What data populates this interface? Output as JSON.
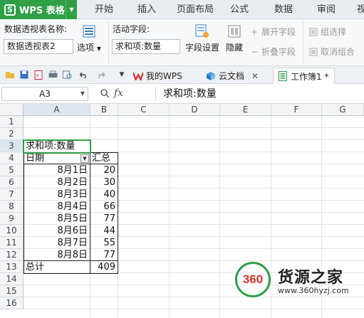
{
  "app": {
    "title": "WPS 表格"
  },
  "menu": [
    "开始",
    "插入",
    "页面布局",
    "公式",
    "数据",
    "审阅",
    "视"
  ],
  "ribbon": {
    "pivot_name_label": "数据透视表名称:",
    "pivot_name_value": "数据透视表2",
    "options_label": "选项",
    "active_field_label": "活动字段:",
    "active_field_value": "求和项:数量",
    "field_settings_label": "字段设置",
    "hide_label": "隐藏",
    "expand_field_label": "展开字段",
    "collapse_field_label": "折叠字段",
    "group_select_label": "组选择",
    "ungroup_label": "取消组合"
  },
  "tabs": {
    "my_wps": "我的WPS",
    "cloud_docs": "云文档",
    "workbook": "工作簿1 *"
  },
  "formula_bar": {
    "name_box": "A3",
    "fx": "fx",
    "formula": "求和项:数量"
  },
  "grid": {
    "columns": [
      "A",
      "B",
      "C",
      "D",
      "E",
      "F",
      "G"
    ],
    "rows": [
      "1",
      "2",
      "3",
      "4",
      "5",
      "6",
      "7",
      "8",
      "9",
      "10",
      "11",
      "12",
      "13",
      "14",
      "15",
      "16"
    ],
    "pivot_header": "求和项:数量",
    "row_label": "日期",
    "sum_label": "汇总",
    "dates": [
      "8月1日",
      "8月2日",
      "8月3日",
      "8月4日",
      "8月5日",
      "8月6日",
      "8月7日",
      "8月8日"
    ],
    "values": [
      "20",
      "30",
      "40",
      "66",
      "77",
      "44",
      "55",
      "77"
    ],
    "total_label": "总计",
    "total_value": "409"
  },
  "watermark": {
    "logo": "360",
    "title": "货源之家",
    "url": "www.360hyzj.com"
  }
}
